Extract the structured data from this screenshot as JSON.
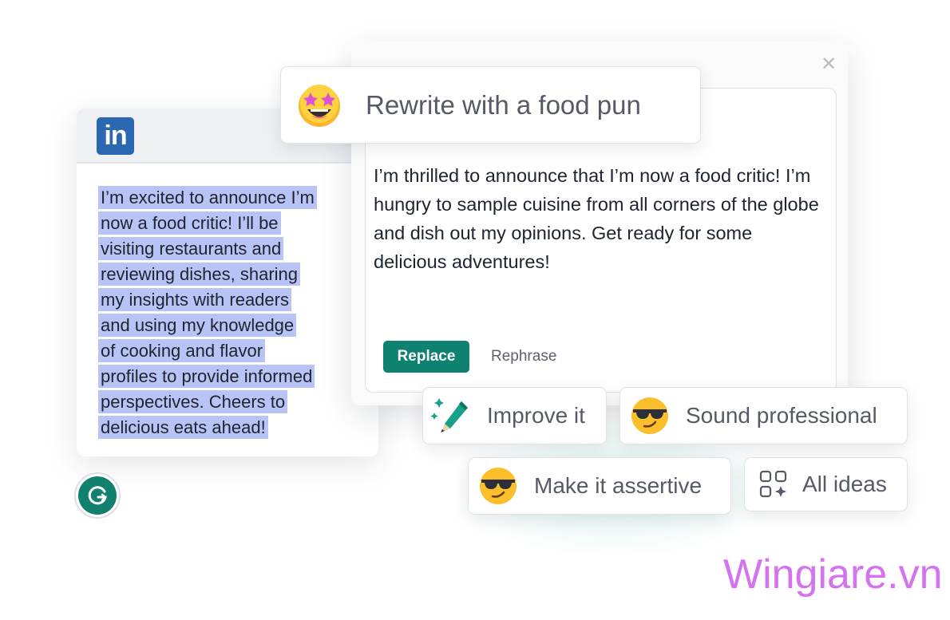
{
  "linkedin": {
    "logo_text": "in",
    "post_lines": [
      "I’m excited to announce I’m",
      "now a food critic! I’ll be",
      "visiting restaurants and",
      "reviewing dishes, sharing",
      "my insights with readers",
      "and using my knowledge",
      "of cooking and flavor",
      "profiles to provide informed",
      "perspectives. Cheers to",
      "delicious eats ahead!"
    ]
  },
  "rewrite_panel": {
    "prompt_label": "Rewrite with a food pun",
    "output_text": "I’m thrilled to announce that I’m now a food critic! I’m hungry to sample cuisine from all corners of the globe and dish out my opinions. Get ready for some delicious adventures!",
    "replace_label": "Replace",
    "rephrase_label": "Rephrase"
  },
  "suggestions": [
    {
      "label": "Improve it",
      "icon": "pencil-sparkle-icon"
    },
    {
      "label": "Sound professional",
      "icon": "sunglasses-emoji-icon"
    },
    {
      "label": "Make it assertive",
      "icon": "sunglasses-emoji-icon"
    },
    {
      "label": "All ideas",
      "icon": "grid-sparkle-icon"
    }
  ],
  "colors": {
    "accent": "#0e8170",
    "highlight": "#b7c4f5",
    "linkedin": "#2c67b2",
    "watermark": "#d572ef"
  },
  "watermark": "Wingiare.vn"
}
